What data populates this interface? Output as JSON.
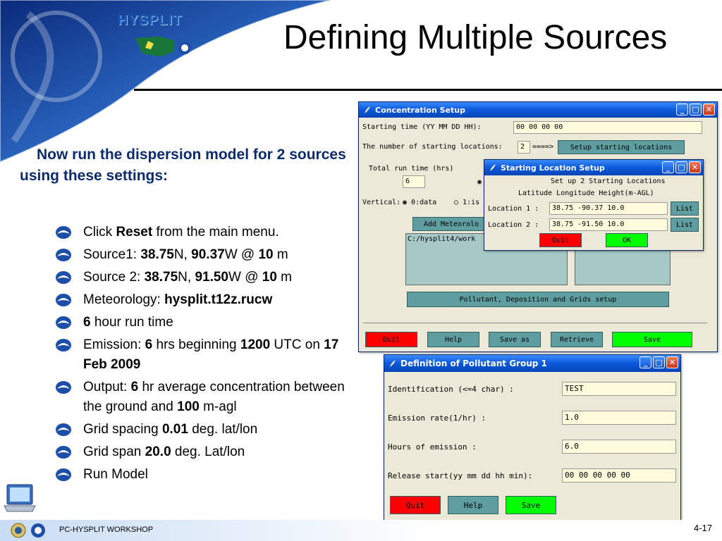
{
  "logo": {
    "text": "HYSPLIT"
  },
  "title": "Defining Multiple Sources",
  "intro": "Now run the dispersion model for 2 sources using these settings:",
  "bullets": [
    {
      "parts": [
        {
          "t": "Click "
        },
        {
          "t": "Reset",
          "b": true
        },
        {
          "t": " from the main menu."
        }
      ]
    },
    {
      "parts": [
        {
          "t": "Source1: "
        },
        {
          "t": "38.75",
          "b": true
        },
        {
          "t": "N, "
        },
        {
          "t": "90.37",
          "b": true
        },
        {
          "t": "W @ "
        },
        {
          "t": "10",
          "b": true
        },
        {
          "t": " m"
        }
      ]
    },
    {
      "parts": [
        {
          "t": "Source 2: "
        },
        {
          "t": "38.75",
          "b": true
        },
        {
          "t": "N, "
        },
        {
          "t": "91.50",
          "b": true
        },
        {
          "t": "W @ "
        },
        {
          "t": "10",
          "b": true
        },
        {
          "t": " m"
        }
      ]
    },
    {
      "parts": [
        {
          "t": "Meteorology: "
        },
        {
          "t": "hysplit.t12z.rucw",
          "b": true
        }
      ]
    },
    {
      "parts": [
        {
          "t": "6",
          "b": true
        },
        {
          "t": " hour run time"
        }
      ]
    },
    {
      "parts": [
        {
          "t": "Emission: "
        },
        {
          "t": "6",
          "b": true
        },
        {
          "t": " hrs beginning "
        },
        {
          "t": "1200",
          "b": true
        },
        {
          "t": " UTC on "
        },
        {
          "t": "17 Feb 2009",
          "b": true
        }
      ]
    },
    {
      "parts": [
        {
          "t": "Output: "
        },
        {
          "t": "6",
          "b": true
        },
        {
          "t": " hr average concentration between the ground and "
        },
        {
          "t": "100",
          "b": true
        },
        {
          "t": " m-agl"
        }
      ]
    },
    {
      "parts": [
        {
          "t": "Grid spacing "
        },
        {
          "t": "0.01",
          "b": true
        },
        {
          "t": " deg. lat/lon"
        }
      ]
    },
    {
      "parts": [
        {
          "t": "Grid span "
        },
        {
          "t": "20.0",
          "b": true
        },
        {
          "t": " deg. Lat/lon"
        }
      ]
    },
    {
      "parts": [
        {
          "t": "Run Model"
        }
      ]
    }
  ],
  "conc_window": {
    "title": "Concentration Setup",
    "starting_time_label": "Starting time    (YY MM DD HH):",
    "starting_time_value": "00 00 00 00",
    "num_locations_label": "The number of starting locations:",
    "num_locations_value": "2",
    "arrow": "====>",
    "setup_locations_button": "Setup starting locations",
    "total_run_label": "Total run time (hrs)",
    "total_run_value": "6",
    "vertical_label": "Vertical:",
    "vertical_opt0": "0:data",
    "vertical_opt1": "1:is",
    "add_met_button": "Add Meteorolo",
    "met_file": "C:/hysplit4/work",
    "pollutant_button": "Pollutant, Deposition and Grids setup",
    "quit": "Quit",
    "help": "Help",
    "save_as": "Save as",
    "retrieve": "Retrieve",
    "save": "Save"
  },
  "start_loc_window": {
    "title": "Starting Location Setup",
    "header1": "Set up 2 Starting Locations",
    "header2": "Latitude Longitude Height(m-AGL)",
    "loc1_label": "Location 1 :",
    "loc1_value": "38.75 -90.37 10.0",
    "loc2_label": "Location 2 :",
    "loc2_value": "38.75 -91.50 10.0",
    "list": "List",
    "quit": "Quit",
    "ok": "OK"
  },
  "pollutant_window": {
    "title": "Definition of Pollutant Group 1",
    "rows": [
      {
        "label": "Identification (<=4 char)     :",
        "value": "TEST"
      },
      {
        "label": "Emission rate(1/hr)           :",
        "value": "1.0"
      },
      {
        "label": "Hours of emission             :",
        "value": "6.0"
      },
      {
        "label": "Release start(yy mm dd hh min):",
        "value": "00 00 00 00 00"
      }
    ],
    "quit": "Quit",
    "help": "Help",
    "save": "Save"
  },
  "footer": {
    "text": "PC-HYSPLIT WORKSHOP",
    "page": "4-17"
  },
  "colors": {
    "title_blue": "#0d2b6b",
    "tk_teal": "#5f9ea0",
    "tk_field": "#fffbdc"
  }
}
